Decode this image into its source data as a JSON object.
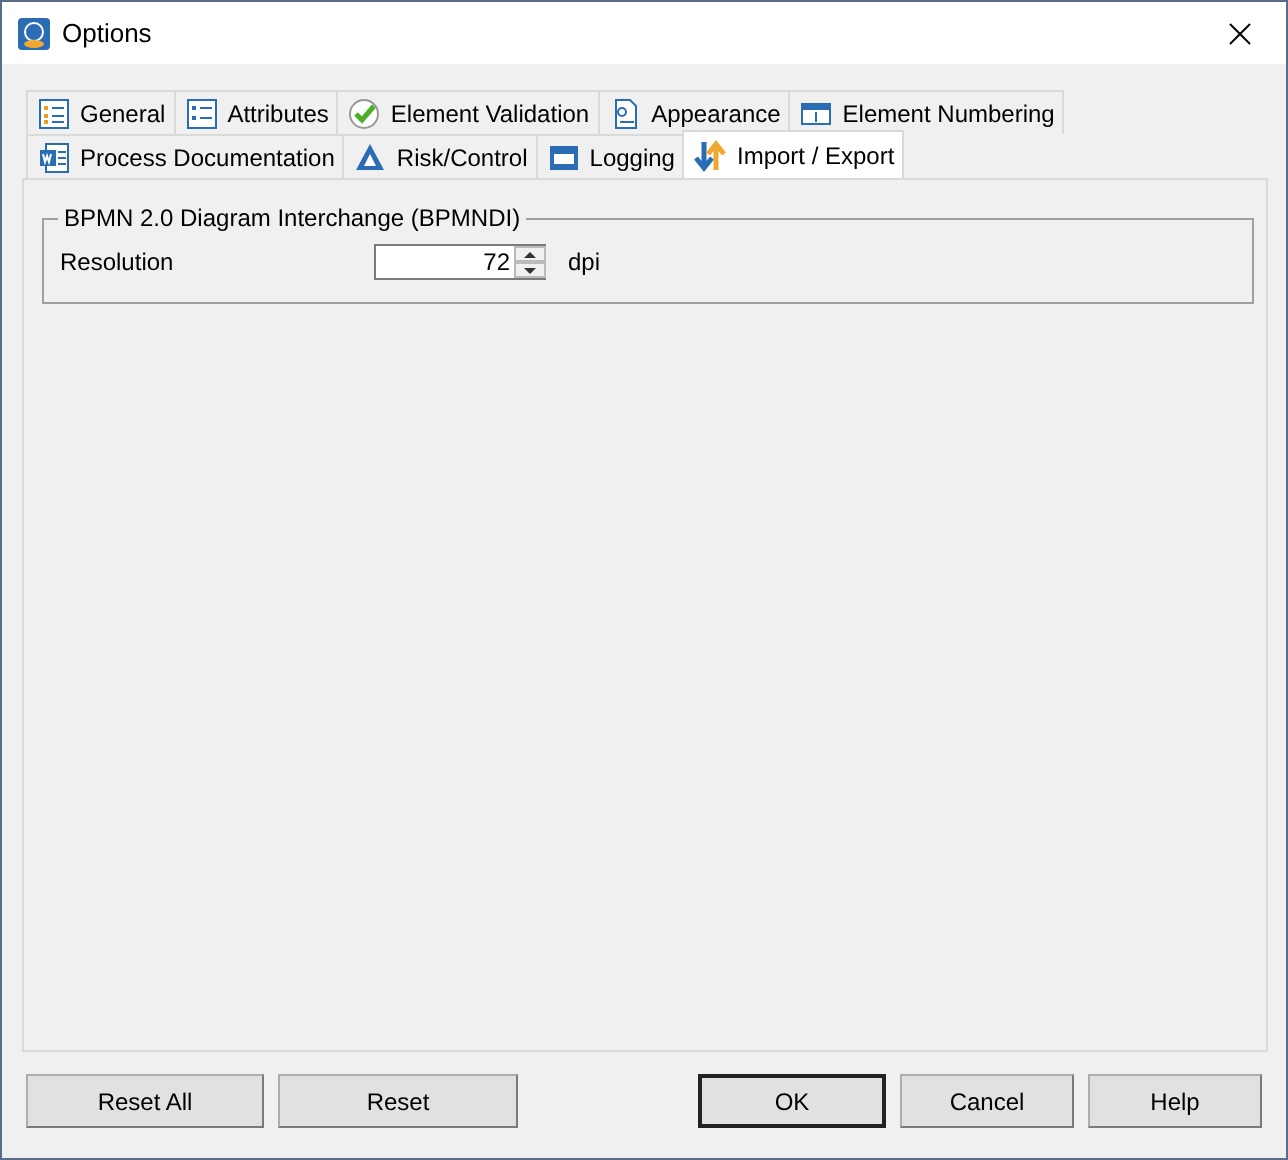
{
  "window": {
    "title": "Options"
  },
  "tab_rows": [
    [
      {
        "label": "General",
        "selected": false
      },
      {
        "label": "Attributes",
        "selected": false
      },
      {
        "label": "Element Validation",
        "selected": false
      },
      {
        "label": "Appearance",
        "selected": false
      },
      {
        "label": "Element Numbering",
        "selected": false
      }
    ],
    [
      {
        "label": "Process Documentation",
        "selected": false
      },
      {
        "label": "Risk/Control",
        "selected": false
      },
      {
        "label": "Logging",
        "selected": false
      },
      {
        "label": "Import / Export",
        "selected": true
      }
    ]
  ],
  "group": {
    "title": "BPMN 2.0 Diagram Interchange (BPMNDI)",
    "fields": [
      {
        "label": "Resolution",
        "value": "72",
        "unit": "dpi"
      }
    ]
  },
  "buttons": [
    {
      "label": "Reset All",
      "default": false
    },
    {
      "label": "Reset",
      "default": false
    },
    {
      "label": "OK",
      "default": true
    },
    {
      "label": "Cancel",
      "default": false
    },
    {
      "label": "Help",
      "default": false
    }
  ]
}
